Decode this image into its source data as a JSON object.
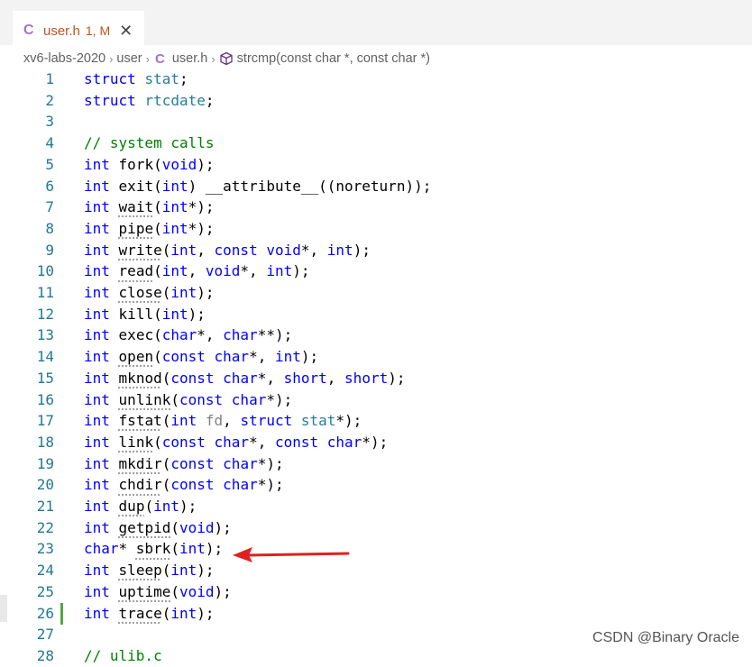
{
  "tab": {
    "icon": "C",
    "filename": "user.h",
    "status": "1, M",
    "close_glyph": "✕"
  },
  "breadcrumb": {
    "items": [
      "xv6-labs-2020",
      "user",
      "user.h",
      "strcmp(const char *, const char *)"
    ],
    "file_icon": "C",
    "separator": "›"
  },
  "editor": {
    "lines": [
      {
        "n": "1",
        "html": "<span class='kw'>struct</span> <span class='ty'>stat</span><span class='txt'>;</span>"
      },
      {
        "n": "2",
        "html": "<span class='kw'>struct</span> <span class='ty'>rtcdate</span><span class='txt'>;</span>"
      },
      {
        "n": "3",
        "html": ""
      },
      {
        "n": "4",
        "html": "<span class='cm'>// system calls</span>"
      },
      {
        "n": "5",
        "html": "<span class='kw'>int</span> <span class='fn'>fork</span><span class='txt'>(</span><span class='kw'>void</span><span class='txt'>);</span>"
      },
      {
        "n": "6",
        "html": "<span class='kw'>int</span> <span class='fn'>exit</span><span class='txt'>(</span><span class='kw'>int</span><span class='txt'>) __attribute__((noreturn));</span>"
      },
      {
        "n": "7",
        "html": "<span class='kw'>int</span> <span class='fn squig'>wait</span><span class='txt'>(</span><span class='kw'>int</span><span class='txt'>*);</span>"
      },
      {
        "n": "8",
        "html": "<span class='kw'>int</span> <span class='fn squig'>pipe</span><span class='txt'>(</span><span class='kw'>int</span><span class='txt'>*);</span>"
      },
      {
        "n": "9",
        "html": "<span class='kw'>int</span> <span class='fn squig'>write</span><span class='txt'>(</span><span class='kw'>int</span><span class='txt'>, </span><span class='kw'>const</span> <span class='kw'>void</span><span class='txt'>*, </span><span class='kw'>int</span><span class='txt'>);</span>"
      },
      {
        "n": "10",
        "html": "<span class='kw'>int</span> <span class='fn squig'>read</span><span class='txt'>(</span><span class='kw'>int</span><span class='txt'>, </span><span class='kw'>void</span><span class='txt'>*, </span><span class='kw'>int</span><span class='txt'>);</span>"
      },
      {
        "n": "11",
        "html": "<span class='kw'>int</span> <span class='fn squig'>close</span><span class='txt'>(</span><span class='kw'>int</span><span class='txt'>);</span>"
      },
      {
        "n": "12",
        "html": "<span class='kw'>int</span> <span class='fn'>kill</span><span class='txt'>(</span><span class='kw'>int</span><span class='txt'>);</span>"
      },
      {
        "n": "13",
        "html": "<span class='kw'>int</span> <span class='fn'>exec</span><span class='txt'>(</span><span class='kw'>char</span><span class='txt'>*, </span><span class='kw'>char</span><span class='txt'>**);</span>"
      },
      {
        "n": "14",
        "html": "<span class='kw'>int</span> <span class='fn squig'>open</span><span class='txt'>(</span><span class='kw'>const</span> <span class='kw'>char</span><span class='txt'>*, </span><span class='kw'>int</span><span class='txt'>);</span>"
      },
      {
        "n": "15",
        "html": "<span class='kw'>int</span> <span class='fn squig'>mknod</span><span class='txt'>(</span><span class='kw'>const</span> <span class='kw'>char</span><span class='txt'>*, </span><span class='kw'>short</span><span class='txt'>, </span><span class='kw'>short</span><span class='txt'>);</span>"
      },
      {
        "n": "16",
        "html": "<span class='kw'>int</span> <span class='fn squig'>unlink</span><span class='txt'>(</span><span class='kw'>const</span> <span class='kw'>char</span><span class='txt'>*);</span>"
      },
      {
        "n": "17",
        "html": "<span class='kw'>int</span> <span class='fn squig'>fstat</span><span class='txt'>(</span><span class='kw'>int</span> <span class='pm'>fd</span><span class='txt'>, </span><span class='kw'>struct</span> <span class='ty'>stat</span><span class='txt'>*);</span>"
      },
      {
        "n": "18",
        "html": "<span class='kw'>int</span> <span class='fn squig'>link</span><span class='txt'>(</span><span class='kw'>const</span> <span class='kw'>char</span><span class='txt'>*, </span><span class='kw'>const</span> <span class='kw'>char</span><span class='txt'>*);</span>"
      },
      {
        "n": "19",
        "html": "<span class='kw'>int</span> <span class='fn squig'>mkdir</span><span class='txt'>(</span><span class='kw'>const</span> <span class='kw'>char</span><span class='txt'>*);</span>"
      },
      {
        "n": "20",
        "html": "<span class='kw'>int</span> <span class='fn squig'>chdir</span><span class='txt'>(</span><span class='kw'>const</span> <span class='kw'>char</span><span class='txt'>*);</span>"
      },
      {
        "n": "21",
        "html": "<span class='kw'>int</span> <span class='fn squig'>dup</span><span class='txt'>(</span><span class='kw'>int</span><span class='txt'>);</span>"
      },
      {
        "n": "22",
        "html": "<span class='kw'>int</span> <span class='fn squig'>getpid</span><span class='txt'>(</span><span class='kw'>void</span><span class='txt'>);</span>"
      },
      {
        "n": "23",
        "html": "<span class='kw'>char</span><span class='txt'>* </span><span class='fn squig'>sbrk</span><span class='txt'>(</span><span class='kw'>int</span><span class='txt'>);</span>"
      },
      {
        "n": "24",
        "html": "<span class='kw'>int</span> <span class='fn squig'>sleep</span><span class='txt'>(</span><span class='kw'>int</span><span class='txt'>);</span>"
      },
      {
        "n": "25",
        "html": "<span class='kw'>int</span> <span class='fn squig'>uptime</span><span class='txt'>(</span><span class='kw'>void</span><span class='txt'>);</span>"
      },
      {
        "n": "26",
        "html": "<span class='kw'>int</span> <span class='fn squig'>trace</span><span class='txt'>(</span><span class='kw'>int</span><span class='txt'>);</span>"
      },
      {
        "n": "27",
        "html": ""
      },
      {
        "n": "28",
        "html": "<span class='cm'>// ulib.c</span>"
      }
    ]
  },
  "watermark": "CSDN @Binary Oracle",
  "colors": {
    "accent_tab_text": "#b9561a",
    "c_icon": "#a074c4",
    "keyword": "#0000ff",
    "type": "#267f99",
    "comment": "#008000",
    "line_number": "#237893",
    "modified_gutter": "#56a34b",
    "arrow": "#e02020"
  }
}
